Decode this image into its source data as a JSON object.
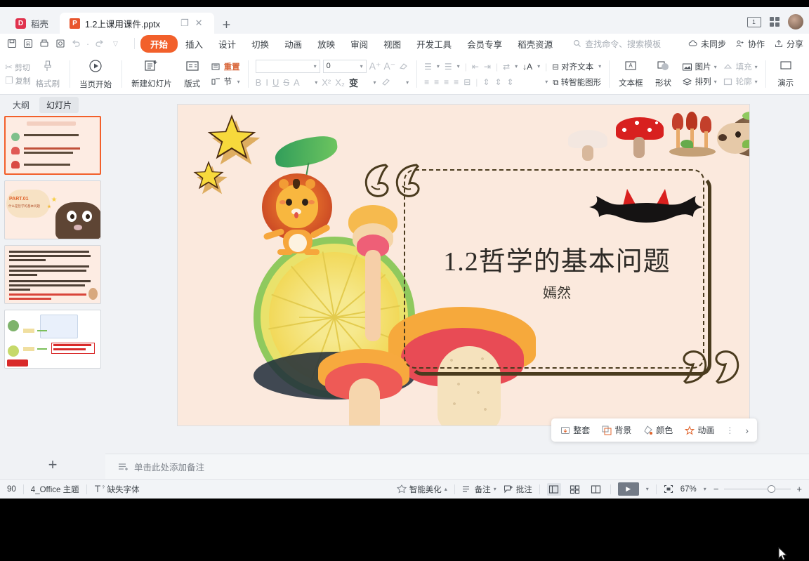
{
  "window": {
    "tabs": [
      {
        "label": "稻壳",
        "icon": "daoke-logo-icon",
        "active": false
      },
      {
        "label": "1.2上课用课件.pptx",
        "icon": "powerpoint-file-icon",
        "active": true
      }
    ],
    "new_tab_label": "+",
    "restore_label": "❐",
    "close_label": "✕"
  },
  "menubar": {
    "quick_access": [
      "save-icon",
      "save-as-icon",
      "print-icon",
      "print-preview-icon",
      "undo-icon",
      "redo-icon",
      "customize-qat-icon"
    ],
    "items": [
      "开始",
      "插入",
      "设计",
      "切换",
      "动画",
      "放映",
      "审阅",
      "视图",
      "开发工具",
      "会员专享",
      "稻壳资源"
    ],
    "active_item": "开始",
    "search_placeholder": "查找命令、搜索模板",
    "right_items": [
      {
        "label": "未同步",
        "icon": "cloud-sync-icon"
      },
      {
        "label": "协作",
        "icon": "collaborate-icon"
      },
      {
        "label": "分享",
        "icon": "share-icon"
      }
    ]
  },
  "ribbon": {
    "clipboard": {
      "cut": "剪切",
      "copy": "复制",
      "format_painter": "格式刷"
    },
    "start_show": "当页开始",
    "new_slide": "新建幻灯片",
    "layout": "版式",
    "section": "节",
    "reset": "重置",
    "font_name": "",
    "font_size": "0",
    "font_buttons": [
      "B",
      "I",
      "U",
      "S",
      "A",
      "X²",
      "X₂"
    ],
    "grow_font": "A⁺",
    "shrink_font": "A⁻",
    "clear_format": "clear-format-icon",
    "align_text": "对齐文本",
    "smart_art": "转智能图形",
    "text_box": "文本框",
    "shape": "形状",
    "picture": "图片",
    "arrange": "排列",
    "fill": "填充",
    "outline": "轮廓",
    "present": "演示"
  },
  "left_panel": {
    "tabs": [
      {
        "label": "大纲",
        "selected": false
      },
      {
        "label": "幻灯片",
        "selected": true
      }
    ],
    "add_slide": "+",
    "thumbnails": [
      {
        "index": 1,
        "selected": true,
        "kind": "contents"
      },
      {
        "index": 2,
        "selected": false,
        "kind": "part01"
      },
      {
        "index": 3,
        "selected": false,
        "kind": "text"
      },
      {
        "index": 4,
        "selected": false,
        "kind": "diagram"
      }
    ]
  },
  "slide": {
    "title": "1.2哲学的基本问题",
    "subtitle": "嫣然",
    "background_color": "#fbe9dd",
    "quote_open": "“",
    "quote_close": "”",
    "decorations": [
      "lion-icon",
      "lemon-slice-icon",
      "star-icon",
      "mushroom-icon",
      "hedgehog-icon",
      "bat-wings-icon",
      "leaf-icon"
    ]
  },
  "notes": {
    "placeholder": "单击此处添加备注",
    "icon": "add-notes-icon"
  },
  "float_toolbar": {
    "items": [
      {
        "label": "整套",
        "icon": "whole-set-icon"
      },
      {
        "label": "背景",
        "icon": "background-icon"
      },
      {
        "label": "颜色",
        "icon": "color-icon"
      },
      {
        "label": "动画",
        "icon": "animation-icon"
      }
    ],
    "more": "⋮",
    "expand": "›"
  },
  "statusbar": {
    "slide_count": "90",
    "theme": "4_Office 主题",
    "missing_font": "缺失字体",
    "missing_font_icon": "missing-font-icon",
    "beautify": "智能美化",
    "notes": "备注",
    "comments": "批注",
    "views": [
      "normal-view-icon",
      "slide-sorter-icon",
      "reading-view-icon"
    ],
    "play": "play-icon",
    "fit_icon": "fit-to-window-icon",
    "zoom": "67%",
    "zoom_out": "−",
    "zoom_in": "+"
  },
  "colors": {
    "accent": "#f2602b",
    "slide_bg": "#fbe9dd",
    "app_bg": "#f2f4f7",
    "ink": "#4a3b1e"
  }
}
